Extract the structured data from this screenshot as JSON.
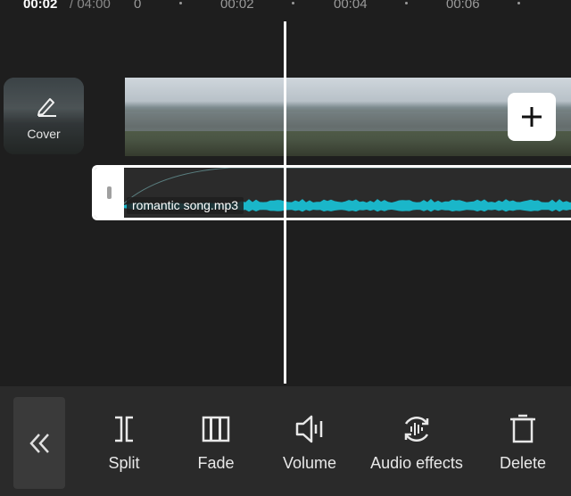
{
  "timeline": {
    "current_time": "00:02",
    "total_time": "/ 04:00",
    "ruler_labels": [
      "00:02",
      "00:04",
      "00:06"
    ],
    "ruler_partial": "0"
  },
  "cover": {
    "label": "Cover",
    "icon": "pencil-icon"
  },
  "video_track": {
    "add_icon": "plus-icon"
  },
  "audio_track": {
    "clip_name": "romantic song.mp3",
    "waveform_color": "#1ab6c9"
  },
  "toolbar": {
    "back_icon": "double-chevron-left-icon",
    "tools": [
      {
        "label": "Split",
        "icon": "split-icon"
      },
      {
        "label": "Fade",
        "icon": "fade-icon"
      },
      {
        "label": "Volume",
        "icon": "volume-icon"
      },
      {
        "label": "Audio effects",
        "icon": "audio-effects-icon"
      },
      {
        "label": "Delete",
        "icon": "delete-icon"
      }
    ]
  }
}
